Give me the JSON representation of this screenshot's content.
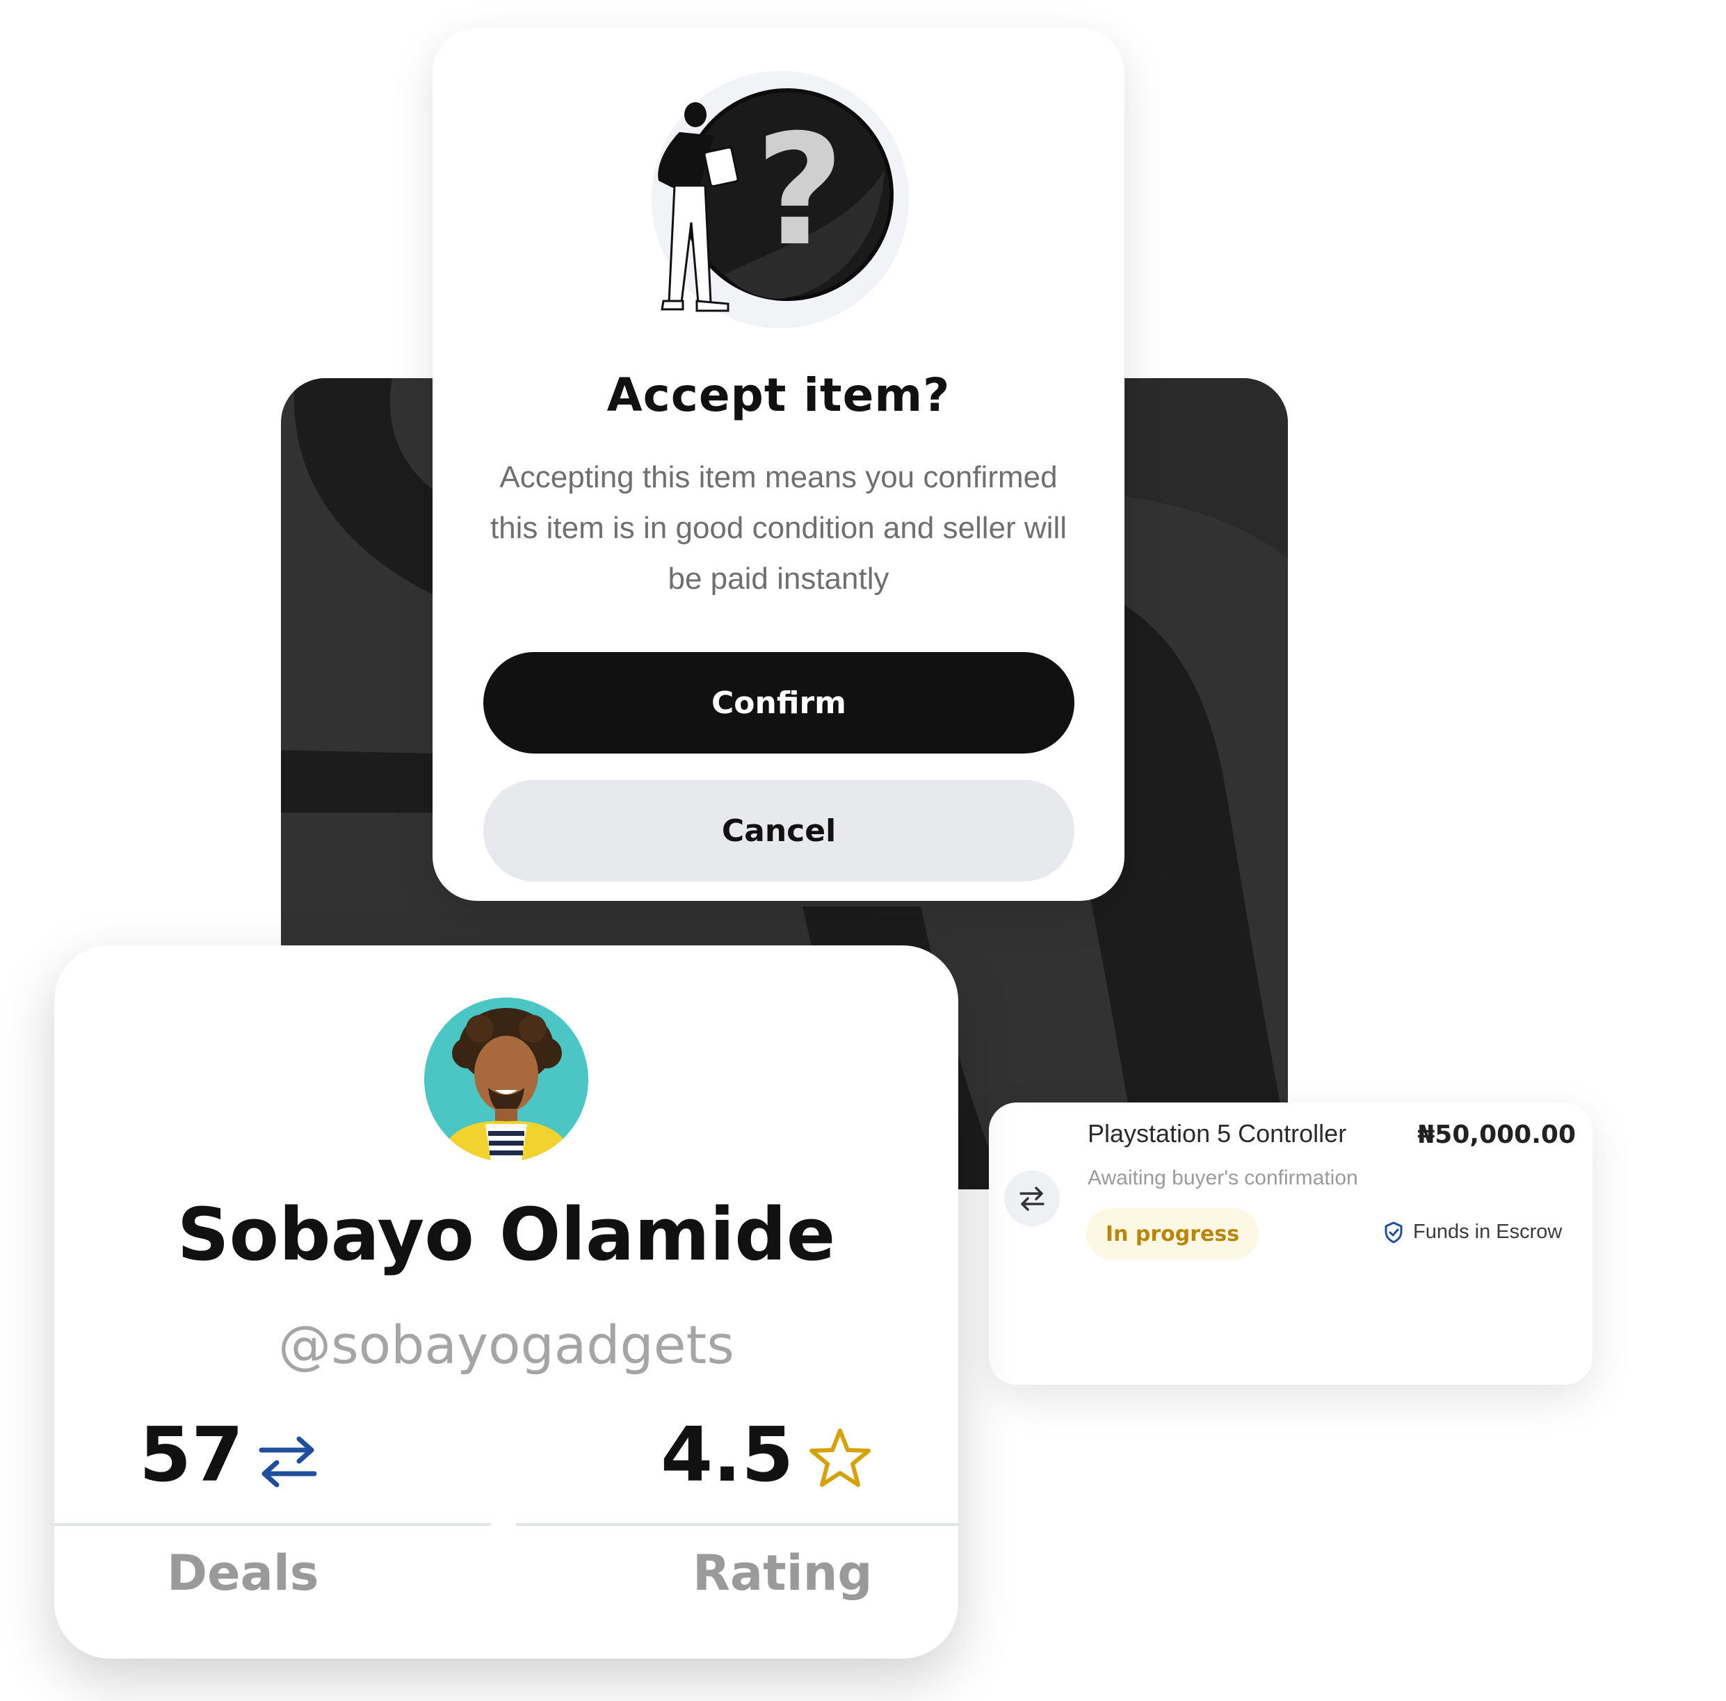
{
  "modal": {
    "title": "Accept item?",
    "description": "Accepting this item means you confirmed this item is in good condition and seller will be paid instantly",
    "confirm_label": "Confirm",
    "cancel_label": "Cancel",
    "illustration_icon": "question-mark-icon"
  },
  "profile": {
    "name": "Sobayo Olamide",
    "handle": "@sobayogadgets",
    "stats": [
      {
        "value": "57",
        "label": "Deals",
        "icon": "swap-arrows-icon",
        "icon_color": "#1f4e9c"
      },
      {
        "value": "4.5",
        "label": "Rating",
        "icon": "star-icon",
        "icon_color": "#d4a20a"
      }
    ]
  },
  "transaction": {
    "title": "Playstation 5 Controller",
    "amount": "₦50,000.00",
    "status_text": "Awaiting buyer's confirmation",
    "badge": "In progress",
    "escrow_label": "Funds in Escrow",
    "icon": "swap-arrows-icon"
  },
  "colors": {
    "accent_dark": "#111111",
    "badge_bg": "#fdf8e3",
    "badge_text": "#b8860b",
    "escrow_icon": "#1f4e9c"
  }
}
